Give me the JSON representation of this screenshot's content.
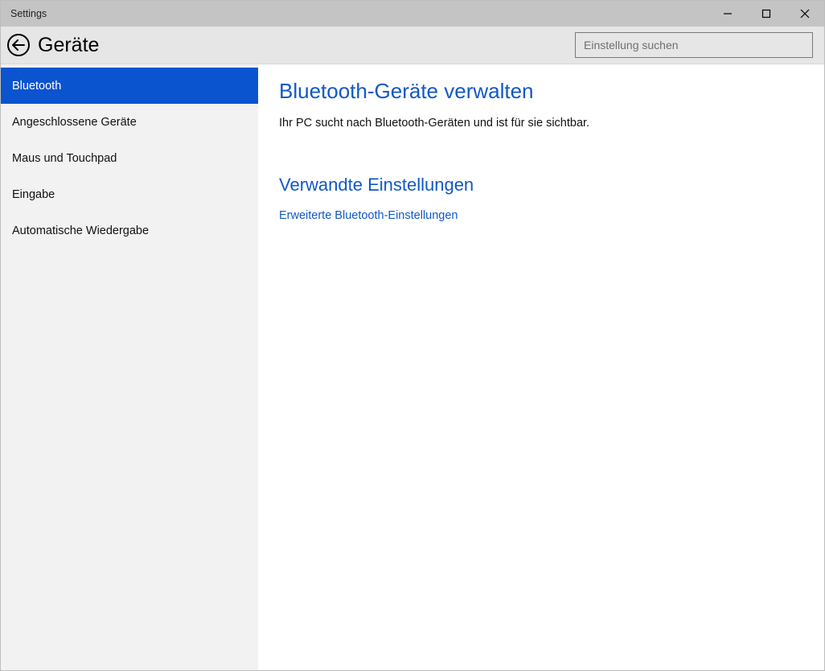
{
  "window": {
    "title": "Settings"
  },
  "header": {
    "title": "Geräte",
    "search_placeholder": "Einstellung suchen"
  },
  "sidebar": {
    "items": [
      {
        "label": "Bluetooth",
        "selected": true
      },
      {
        "label": "Angeschlossene Geräte",
        "selected": false
      },
      {
        "label": "Maus und Touchpad",
        "selected": false
      },
      {
        "label": "Eingabe",
        "selected": false
      },
      {
        "label": "Automatische Wiedergabe",
        "selected": false
      }
    ]
  },
  "content": {
    "heading": "Bluetooth-Geräte verwalten",
    "description": "Ihr PC sucht nach Bluetooth-Geräten und ist für sie sichtbar.",
    "related_heading": "Verwandte Einstellungen",
    "related_link": "Erweiterte Bluetooth-Einstellungen"
  }
}
